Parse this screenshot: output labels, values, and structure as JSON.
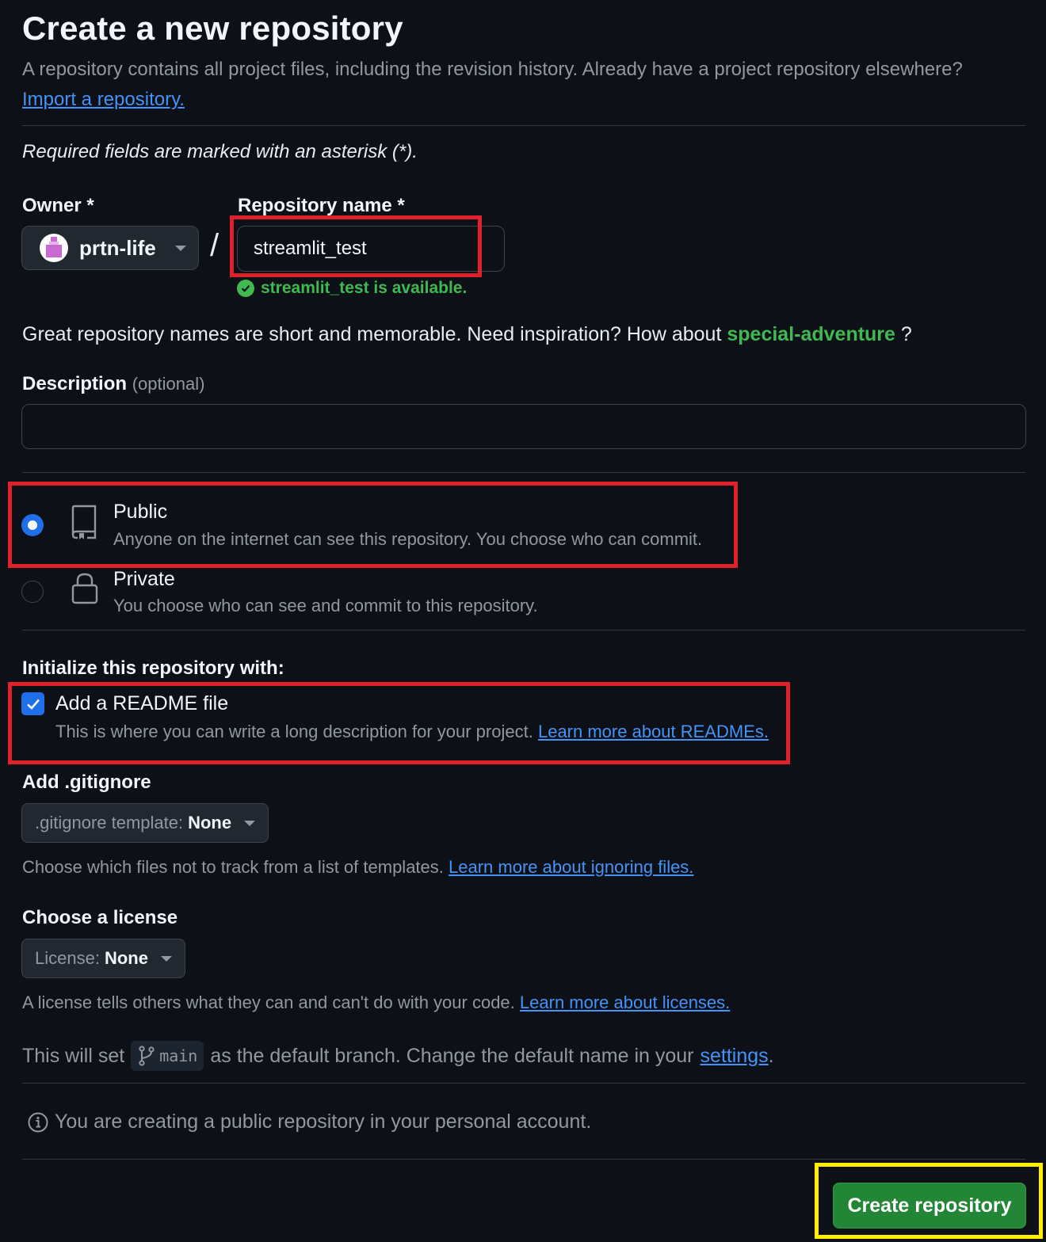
{
  "header": {
    "title": "Create a new repository",
    "subtitle": "A repository contains all project files, including the revision history. Already have a project repository elsewhere?",
    "import_link": "Import a repository."
  },
  "form": {
    "required_note": "Required fields are marked with an asterisk (*).",
    "owner_label": "Owner *",
    "owner_value": "prtn-life",
    "repo_label": "Repository name *",
    "repo_value": "streamlit_test",
    "availability": "streamlit_test is available.",
    "inspiration_text": "Great repository names are short and memorable. Need inspiration? How about",
    "suggestion": "special-adventure",
    "inspiration_end": "?",
    "description_label": "Description",
    "description_optional": "(optional)",
    "description_value": ""
  },
  "visibility": {
    "selected": "public",
    "public_title": "Public",
    "public_desc": "Anyone on the internet can see this repository. You choose who can commit.",
    "private_title": "Private",
    "private_desc": "You choose who can see and commit to this repository."
  },
  "init": {
    "label": "Initialize this repository with:",
    "readme_checked": true,
    "readme_title": "Add a README file",
    "readme_desc": "This is where you can write a long description for your project.",
    "readme_link": "Learn more about READMEs."
  },
  "gitignore": {
    "label": "Add .gitignore",
    "select_prefix": ".gitignore template:",
    "select_value": "None",
    "help": "Choose which files not to track from a list of templates.",
    "help_link": "Learn more about ignoring files."
  },
  "license": {
    "label": "Choose a license",
    "select_prefix": "License:",
    "select_value": "None",
    "help": "A license tells others what they can and can't do with your code.",
    "help_link": "Learn more about licenses."
  },
  "branch": {
    "prefix": "This will set",
    "name": "main",
    "middle": "as the default branch. Change the default name in your",
    "settings_link": "settings",
    "suffix": "."
  },
  "info": {
    "text": "You are creating a public repository in your personal account."
  },
  "actions": {
    "create_label": "Create repository"
  },
  "colors": {
    "background": "#0d1117",
    "accent_blue": "#1f6feb",
    "link": "#4493f8",
    "success": "#3fb950",
    "create_button": "#238636",
    "annotation_red": "#e0202a",
    "annotation_yellow": "#ffee00"
  }
}
